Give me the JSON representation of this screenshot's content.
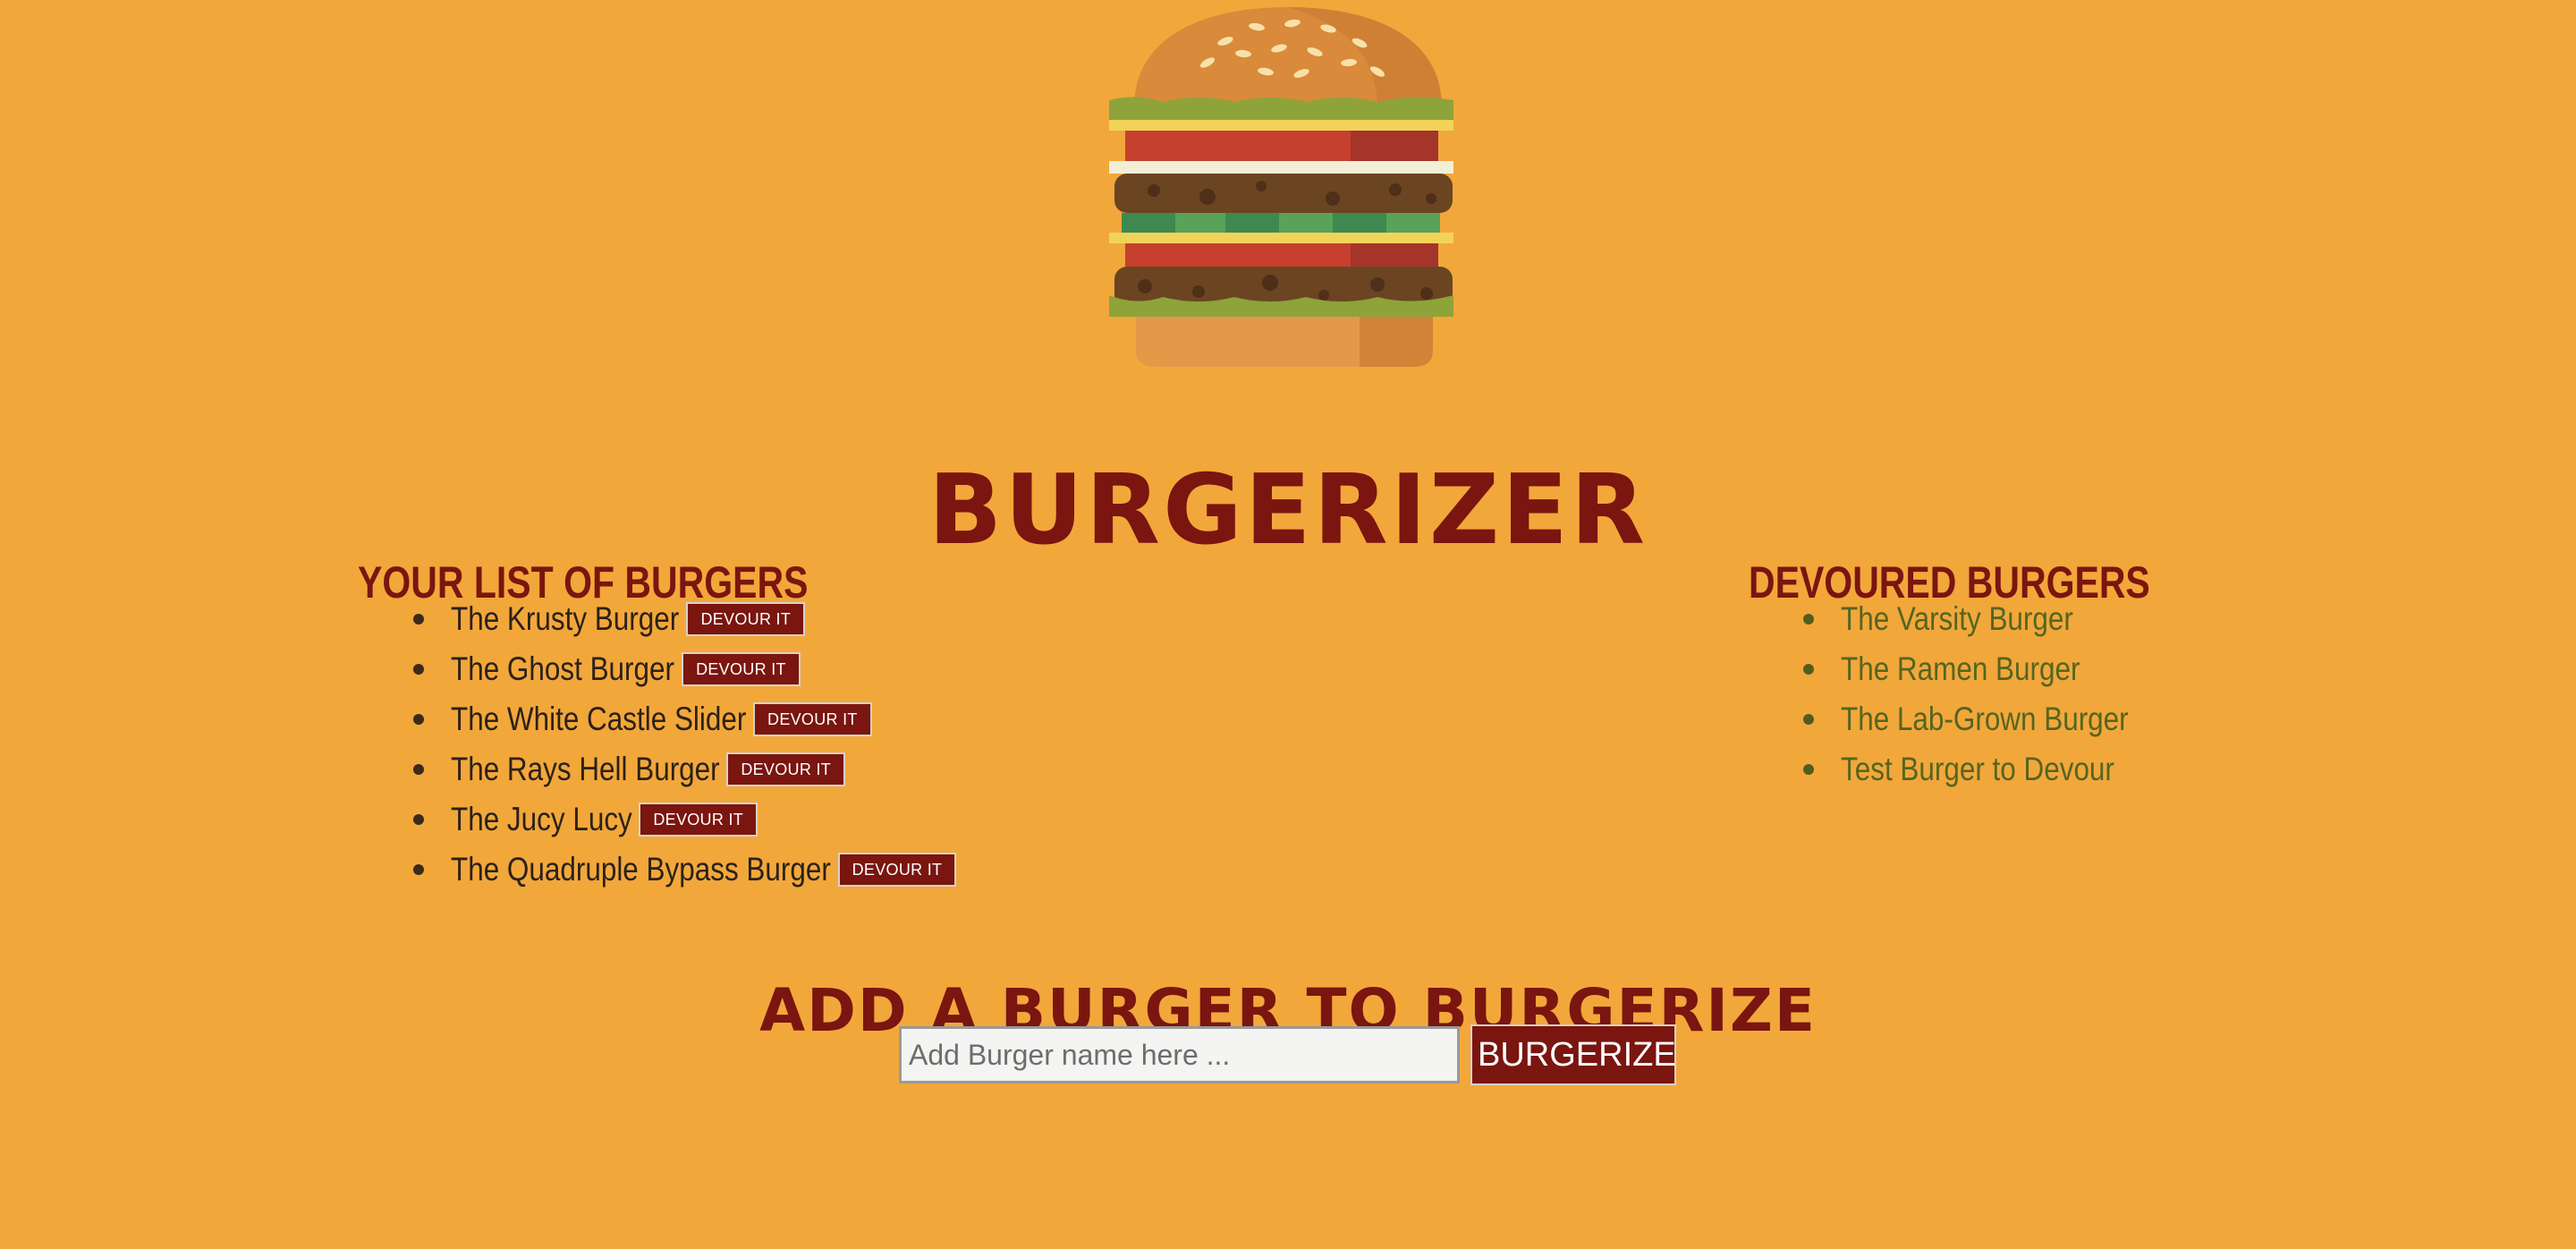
{
  "app": {
    "title": "BURGERIZER"
  },
  "icons": {
    "logo": "hamburger-icon"
  },
  "colors": {
    "background": "#f2a73b",
    "accent": "#7a1510",
    "devoured_text": "#55651f",
    "button_text": "#ffffff"
  },
  "uneaten": {
    "heading": "YOUR LIST OF BURGERS",
    "button_label": "DEVOUR IT",
    "items": [
      {
        "name": "The Krusty Burger"
      },
      {
        "name": "The Ghost Burger"
      },
      {
        "name": "The White Castle Slider"
      },
      {
        "name": "The Rays Hell Burger"
      },
      {
        "name": "The Jucy Lucy"
      },
      {
        "name": "The Quadruple Bypass Burger"
      }
    ]
  },
  "devoured": {
    "heading": "DEVOURED BURGERS",
    "items": [
      {
        "name": "The Varsity Burger"
      },
      {
        "name": "The Ramen Burger"
      },
      {
        "name": "The Lab-Grown Burger"
      },
      {
        "name": "Test Burger to Devour"
      }
    ]
  },
  "add_form": {
    "heading": "ADD A BURGER TO BURGERIZE",
    "placeholder": "Add Burger name here ...",
    "value": "",
    "submit_label": "BURGERIZE"
  }
}
